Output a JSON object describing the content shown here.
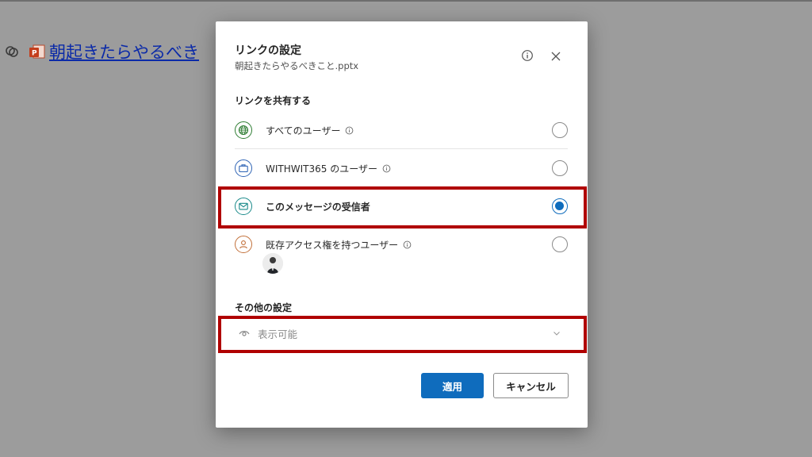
{
  "background": {
    "file_link": "朝起きたらやるべき"
  },
  "dialog": {
    "title": "リンクの設定",
    "file_name": "朝起きたらやるべきこと.pptx",
    "share_section_label": "リンクを共有する",
    "options": [
      {
        "label": "すべてのユーザー",
        "icon": "globe-icon",
        "color": "#2e7d32",
        "selected": false,
        "has_info": true
      },
      {
        "label": "WITHWIT365 のユーザー",
        "icon": "briefcase-icon",
        "color": "#2f64b5",
        "selected": false,
        "has_info": true
      },
      {
        "label": "このメッセージの受信者",
        "icon": "mail-icon",
        "color": "#1a8a8a",
        "selected": true,
        "has_info": false
      },
      {
        "label": "既存アクセス権を持つユーザー",
        "icon": "person-icon",
        "color": "#c2703a",
        "selected": false,
        "has_info": true
      }
    ],
    "other_settings_label": "その他の設定",
    "permission_dropdown": {
      "value": "表示可能",
      "icon": "eye-icon"
    },
    "apply_label": "適用",
    "cancel_label": "キャンセル"
  },
  "colors": {
    "accent": "#0f6cbd",
    "highlight_box": "#b00000"
  }
}
